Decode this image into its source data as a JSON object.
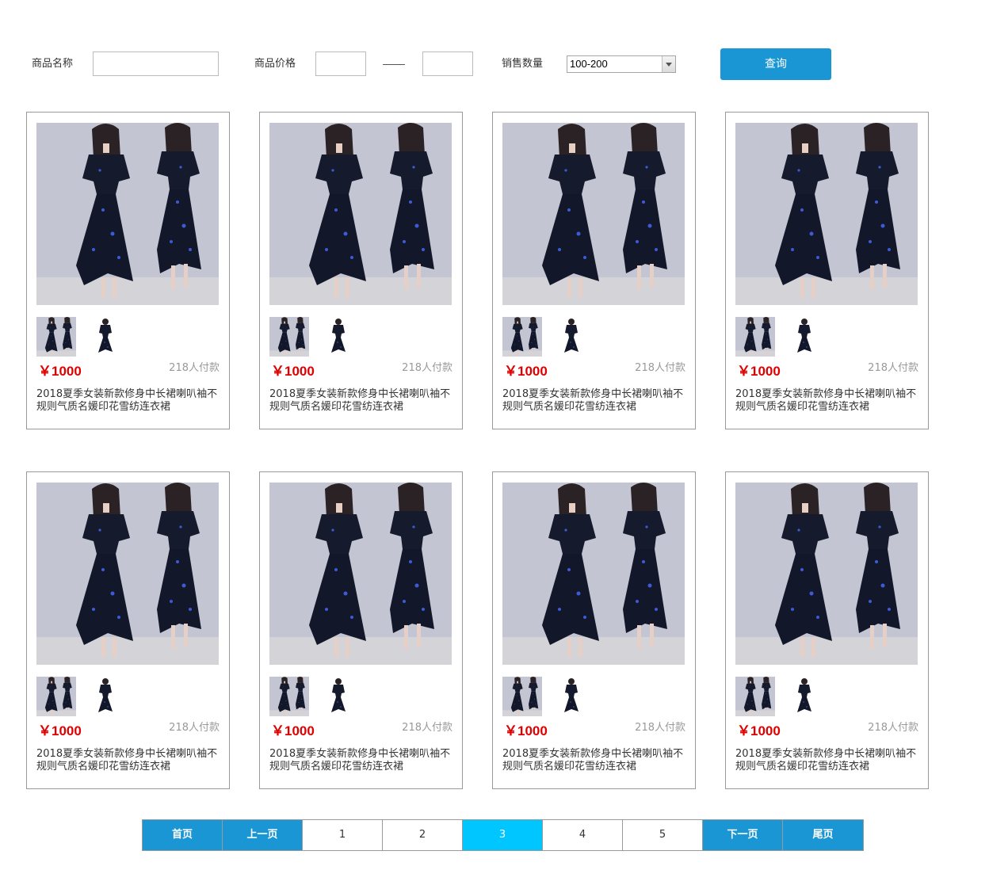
{
  "search": {
    "name_label": "商品名称",
    "name_value": "",
    "price_label": "商品价格",
    "price_min": "",
    "price_max": "",
    "price_separator": "——",
    "sales_label": "销售数量",
    "sales_selected": "100-200",
    "query_label": "查询"
  },
  "products": [
    {
      "price": "￥1000",
      "sold": "218人付款",
      "title": "2018夏季女装新款修身中长裙喇叭袖不规则气质名媛印花雪纺连衣裙"
    },
    {
      "price": "￥1000",
      "sold": "218人付款",
      "title": "2018夏季女装新款修身中长裙喇叭袖不规则气质名媛印花雪纺连衣裙"
    },
    {
      "price": "￥1000",
      "sold": "218人付款",
      "title": "2018夏季女装新款修身中长裙喇叭袖不规则气质名媛印花雪纺连衣裙"
    },
    {
      "price": "￥1000",
      "sold": "218人付款",
      "title": "2018夏季女装新款修身中长裙喇叭袖不规则气质名媛印花雪纺连衣裙"
    },
    {
      "price": "￥1000",
      "sold": "218人付款",
      "title": "2018夏季女装新款修身中长裙喇叭袖不规则气质名媛印花雪纺连衣裙"
    },
    {
      "price": "￥1000",
      "sold": "218人付款",
      "title": "2018夏季女装新款修身中长裙喇叭袖不规则气质名媛印花雪纺连衣裙"
    },
    {
      "price": "￥1000",
      "sold": "218人付款",
      "title": "2018夏季女装新款修身中长裙喇叭袖不规则气质名媛印花雪纺连衣裙"
    },
    {
      "price": "￥1000",
      "sold": "218人付款",
      "title": "2018夏季女装新款修身中长裙喇叭袖不规则气质名媛印花雪纺连衣裙"
    }
  ],
  "pagination": {
    "first": "首页",
    "prev": "上一页",
    "pages": [
      "1",
      "2",
      "3",
      "4",
      "5"
    ],
    "current": "3",
    "next": "下一页",
    "last": "尾页"
  },
  "colors": {
    "accent": "#1a96d4",
    "active_page": "#00c6ff",
    "price": "#e00000"
  }
}
